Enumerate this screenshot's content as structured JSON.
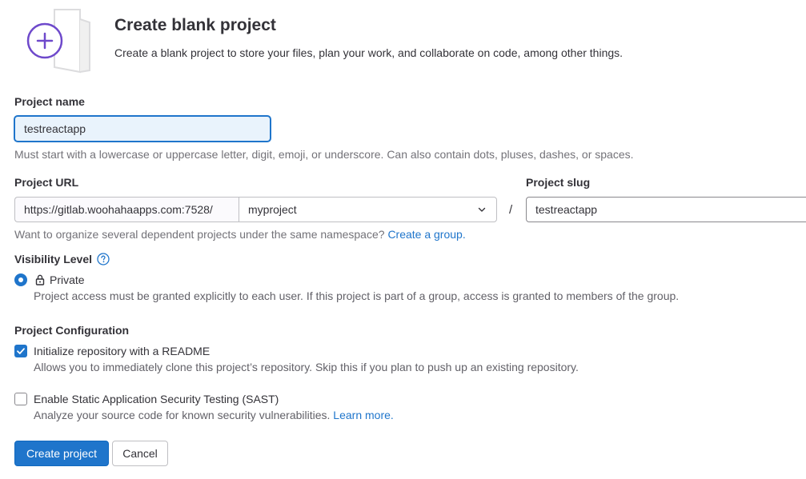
{
  "header": {
    "title": "Create blank project",
    "description": "Create a blank project to store your files, plan your work, and collaborate on code, among other things."
  },
  "project_name": {
    "label": "Project name",
    "value": "testreactapp",
    "help": "Must start with a lowercase or uppercase letter, digit, emoji, or underscore. Can also contain dots, pluses, dashes, or spaces."
  },
  "project_url": {
    "label": "Project URL",
    "prefix": "https://gitlab.woohahaapps.com:7528/",
    "namespace": "myproject",
    "separator": "/",
    "help": "Want to organize several dependent projects under the same namespace?",
    "help_link": "Create a group."
  },
  "project_slug": {
    "label": "Project slug",
    "value": "testreactapp"
  },
  "visibility": {
    "label": "Visibility Level",
    "option_label": "Private",
    "option_desc": "Project access must be granted explicitly to each user. If this project is part of a group, access is granted to members of the group."
  },
  "configuration": {
    "label": "Project Configuration",
    "readme": {
      "label": "Initialize repository with a README",
      "desc": "Allows you to immediately clone this project’s repository. Skip this if you plan to push up an existing repository.",
      "checked": true
    },
    "sast": {
      "label": "Enable Static Application Security Testing (SAST)",
      "desc": "Analyze your source code for known security vulnerabilities.",
      "link": "Learn more.",
      "checked": false
    }
  },
  "actions": {
    "create": "Create project",
    "cancel": "Cancel"
  },
  "colors": {
    "primary": "#1f75cb",
    "illustration_accent": "#6e49cb"
  }
}
